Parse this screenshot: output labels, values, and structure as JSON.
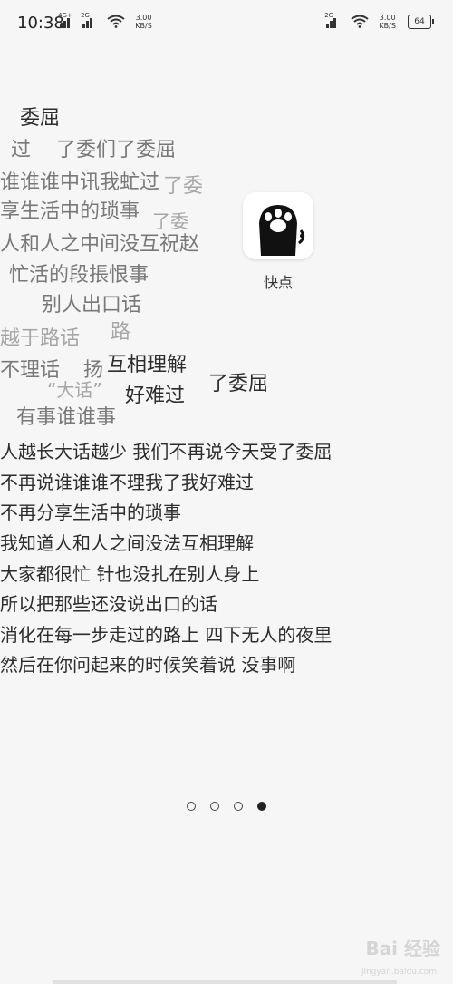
{
  "status_bar": {
    "time": "10:38",
    "left_net_1": "4G+",
    "left_net_2": "2G",
    "left_speed_value": "3.00",
    "left_speed_unit": "KB/S",
    "right_net": "2G",
    "right_speed_value": "3.00",
    "right_speed_unit": "KB/S",
    "battery": "64"
  },
  "app": {
    "label": "快点",
    "icon": "black-cat-paw-icon",
    "icon_bg": "#ffffff"
  },
  "animated_lyrics": [
    "委屈",
    "过",
    "了委们了委屈",
    "谁谁谁中讯我虻过",
    "了委",
    "享生活中的琐事",
    "了委",
    "人和人之中间没互祝赵",
    "忙活的段掁恨事",
    "别人出口话",
    "越于路话",
    "路",
    "不理话",
    "扬",
    "互相理解",
    "“大话”",
    "好难过",
    "了委屈",
    "有事谁谁事"
  ],
  "lyrics": [
    "人越长大话越少 我们不再说今天受了委屈",
    "不再说谁谁谁不理我了我好难过",
    "不再分享生活中的琐事",
    "我知道人和人之间没法互相理解",
    "大家都很忙 针也没扎在别人身上",
    "所以把那些还没说出口的话",
    "消化在每一步走过的路上 四下无人的夜里",
    "然后在你问起来的时候笑着说 没事啊"
  ],
  "page_indicator": {
    "total": 4,
    "current": 4
  },
  "watermark": {
    "main": "Bai 经验",
    "sub": "jingyan.baidu.com"
  }
}
